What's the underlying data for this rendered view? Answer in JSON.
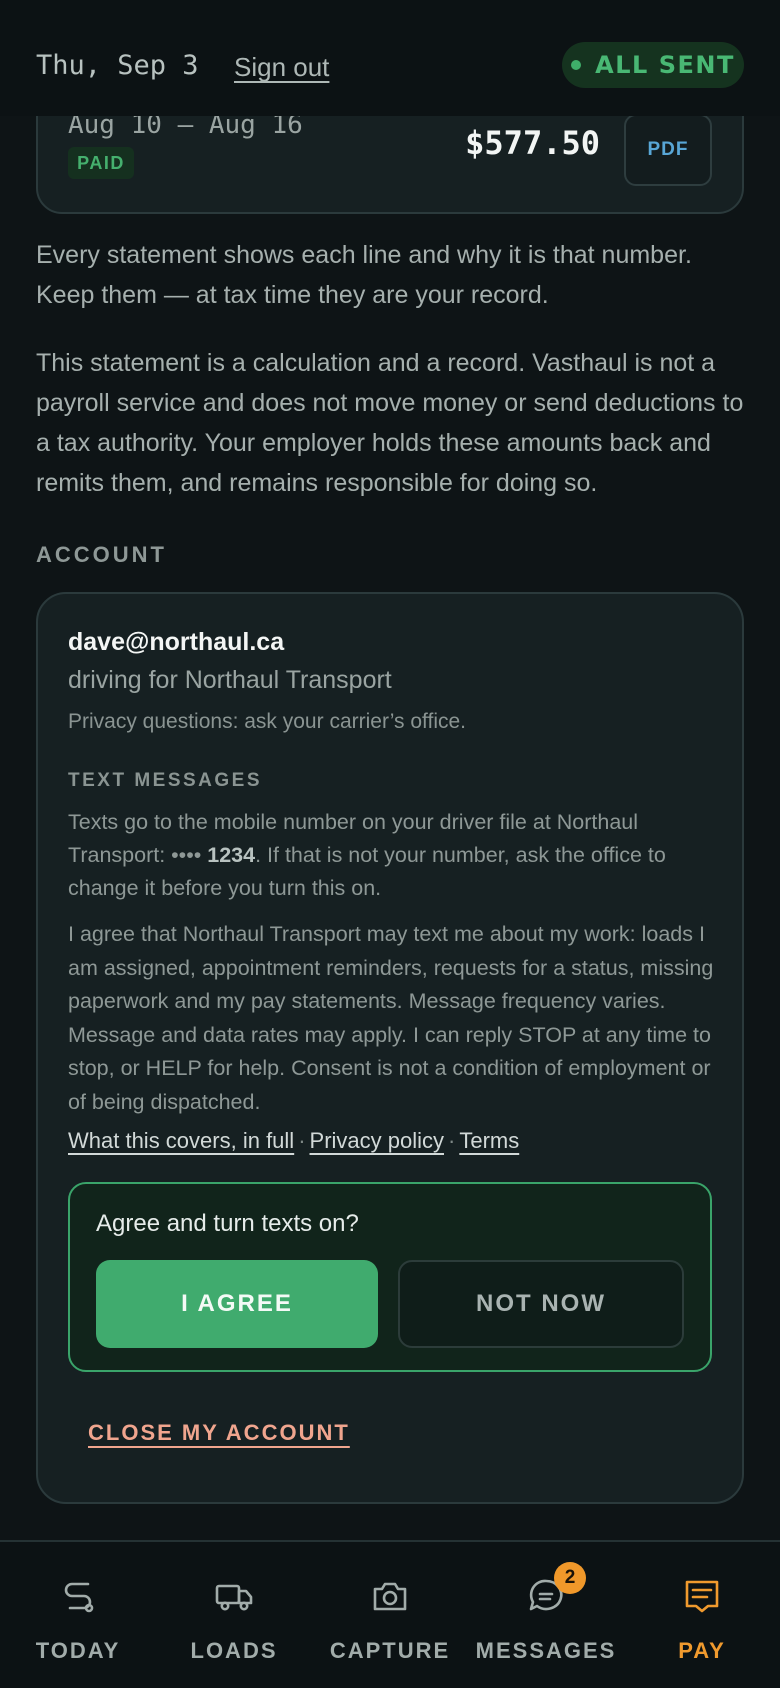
{
  "header": {
    "date": "Thu, Sep 3",
    "sign_out": "Sign out",
    "status": "ALL SENT",
    "status_color": "#49b874"
  },
  "statement": {
    "range": "Aug 10 – Aug 16",
    "status": "PAID",
    "amount": "$577.50",
    "pdf_label": "PDF"
  },
  "info": {
    "paragraph1": "Every statement shows each line and why it is that number. Keep them — at tax time they are your record.",
    "paragraph2": "This statement is a calculation and a record. Vasthaul is not a payroll service and does not move money or send deductions to a tax authority. Your employer holds these amounts back and remits them, and remains responsible for doing so."
  },
  "account": {
    "section_title": "ACCOUNT",
    "email": "dave@northaul.ca",
    "driving_for": "driving for Northaul Transport",
    "privacy_note": "Privacy questions: ask your carrier’s office.",
    "texts_title": "TEXT MESSAGES",
    "texts_desc_prefix": "Texts go to the mobile number on your driver file at Northaul Transport: •••• ",
    "phone_last4": "1234",
    "texts_desc_suffix": ". If that is not your number, ask the office to change it before you turn this on.",
    "consent": "I agree that Northaul Transport may text me about my work: loads I am assigned, appointment reminders, requests for a status, missing paperwork and my pay statements. Message frequency varies. Message and data rates may apply. I can reply STOP at any time to stop, or HELP for help. Consent is not a condition of employment or of being dispatched.",
    "links": {
      "covers": "What this covers, in full",
      "privacy": "Privacy policy",
      "terms": "Terms",
      "separator": "·"
    },
    "agree_prompt": "Agree and turn texts on?",
    "agree_button": "I AGREE",
    "not_now_button": "NOT NOW",
    "close_account": "CLOSE MY ACCOUNT"
  },
  "nav": {
    "items": [
      {
        "label": "TODAY",
        "icon": "route-icon"
      },
      {
        "label": "LOADS",
        "icon": "truck-icon"
      },
      {
        "label": "CAPTURE",
        "icon": "camera-icon"
      },
      {
        "label": "MESSAGES",
        "icon": "chat-icon",
        "badge": "2"
      },
      {
        "label": "PAY",
        "icon": "receipt-icon",
        "active": true
      }
    ],
    "active_color": "#f09a2e"
  }
}
